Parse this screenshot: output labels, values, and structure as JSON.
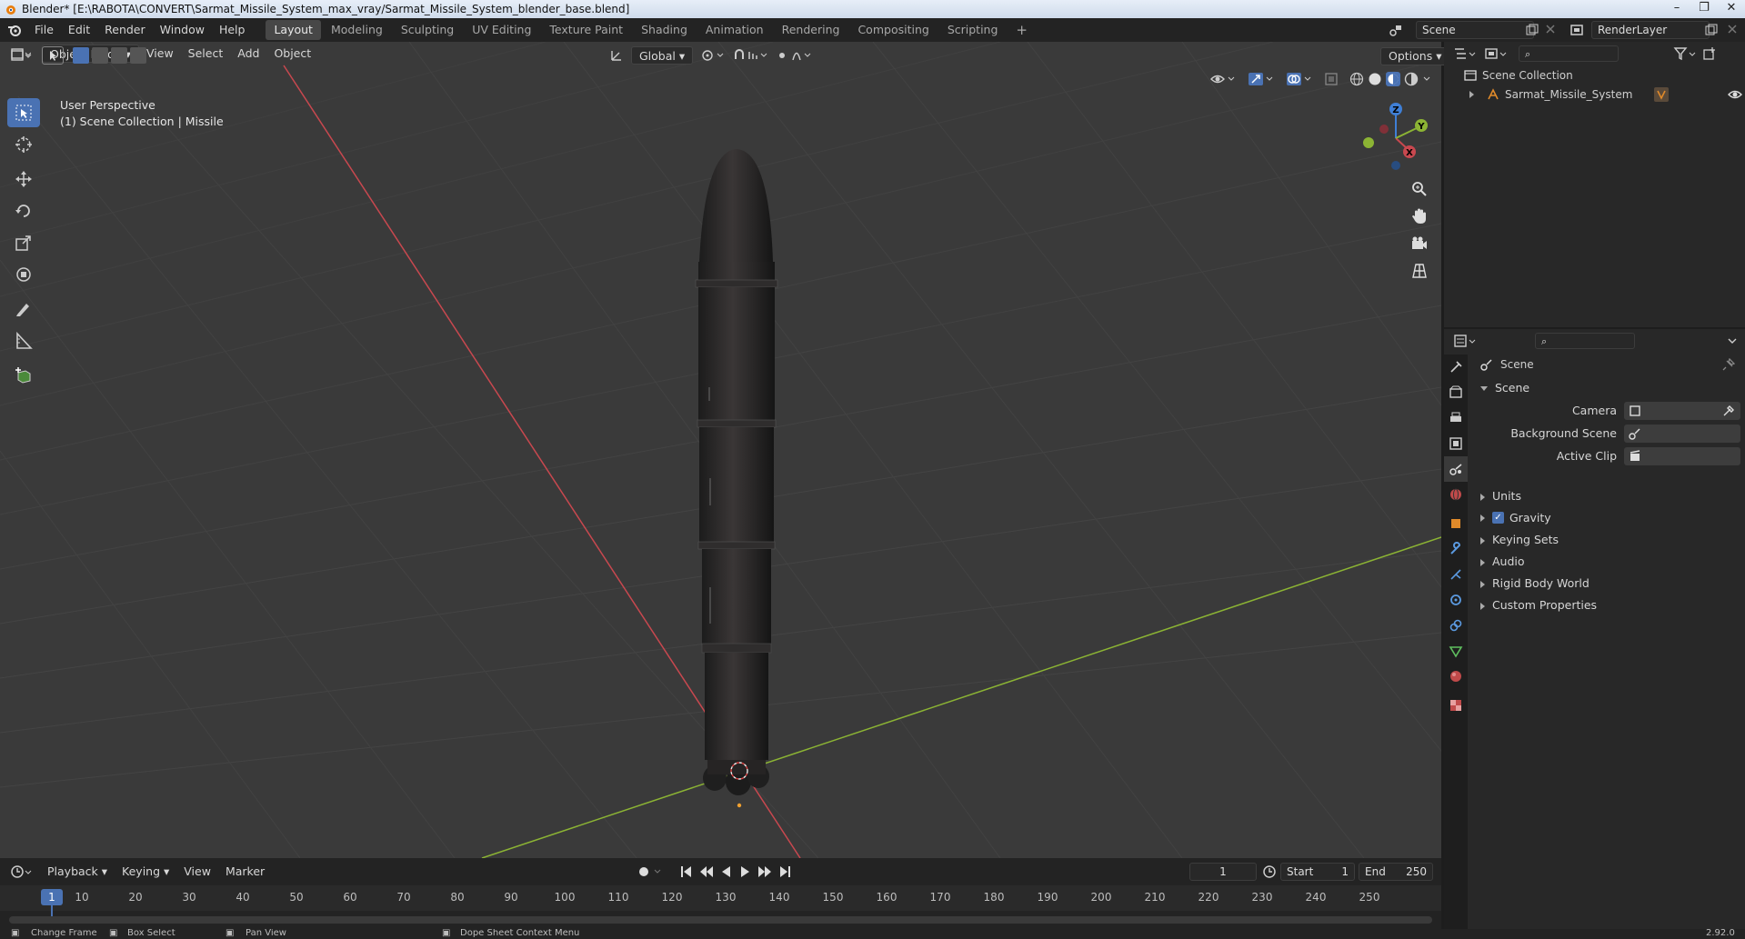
{
  "window": {
    "title": "Blender* [E:\\RABOTA\\CONVERT\\Sarmat_Missile_System_max_vray/Sarmat_Missile_System_blender_base.blend]"
  },
  "topbar": {
    "menus": [
      "File",
      "Edit",
      "Render",
      "Window",
      "Help"
    ],
    "workspaces": [
      "Layout",
      "Modeling",
      "Sculpting",
      "UV Editing",
      "Texture Paint",
      "Shading",
      "Animation",
      "Rendering",
      "Compositing",
      "Scripting"
    ],
    "active_workspace": "Layout",
    "add_tab": "+",
    "scene": "Scene",
    "view_layer": "RenderLayer"
  },
  "viewport": {
    "mode": "Object Mode",
    "menus": [
      "View",
      "Select",
      "Add",
      "Object"
    ],
    "transform_orientation": "Global",
    "options_label": "Options",
    "perspective_label": "User Perspective",
    "collection_label": "(1) Scene Collection | Missile",
    "gizmo": {
      "x": "X",
      "y": "Y",
      "z": "Z"
    }
  },
  "timeline": {
    "menus": [
      "Playback",
      "Keying",
      "View",
      "Marker"
    ],
    "current_frame": "1",
    "start_label": "Start",
    "start": "1",
    "end_label": "End",
    "end": "250",
    "ruler_ticks": [
      "1",
      "10",
      "20",
      "30",
      "40",
      "50",
      "60",
      "70",
      "80",
      "90",
      "100",
      "110",
      "120",
      "130",
      "140",
      "150",
      "160",
      "170",
      "180",
      "190",
      "200",
      "210",
      "220",
      "230",
      "240",
      "250"
    ]
  },
  "statusbar": {
    "items": [
      "Change Frame",
      "Box Select",
      "Pan View",
      "Dope Sheet Context Menu"
    ],
    "version": "2.92.0"
  },
  "outliner": {
    "root": "Scene Collection",
    "items": [
      {
        "label": "Sarmat_Missile_System"
      }
    ]
  },
  "properties": {
    "context": "Scene",
    "section": "Scene",
    "camera_label": "Camera",
    "background_scene_label": "Background Scene",
    "active_clip_label": "Active Clip",
    "panels": [
      "Units",
      "Gravity",
      "Keying Sets",
      "Audio",
      "Rigid Body World",
      "Custom Properties"
    ],
    "gravity_checked": true
  },
  "colors": {
    "accent": "#4a72b3",
    "x_axis": "#c8484f",
    "y_axis": "#8cb434",
    "z_axis": "#3f7fd6"
  }
}
